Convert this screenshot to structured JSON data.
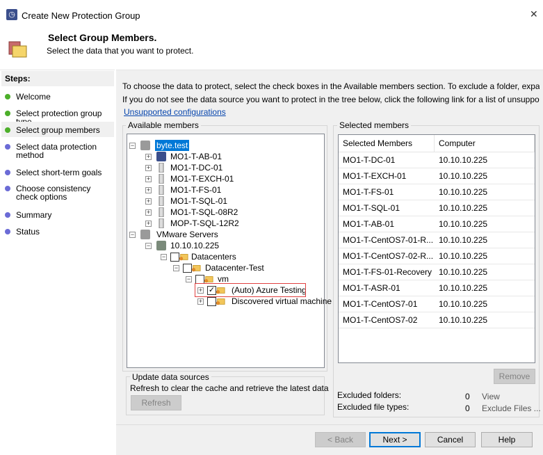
{
  "window": {
    "title": "Create New Protection Group",
    "close": "✕"
  },
  "header": {
    "title": "Select Group Members.",
    "subtitle": "Select the data that you want to protect."
  },
  "steps": {
    "heading": "Steps:",
    "items": [
      {
        "label": "Welcome",
        "state": "done"
      },
      {
        "label": "Select protection group type",
        "state": "done"
      },
      {
        "label": "Select group members",
        "state": "current"
      },
      {
        "label": "Select data protection method",
        "state": "pending"
      },
      {
        "label": "Select short-term goals",
        "state": "pending"
      },
      {
        "label": "Choose consistency check options",
        "state": "pending"
      },
      {
        "label": "Summary",
        "state": "pending"
      },
      {
        "label": "Status",
        "state": "pending"
      }
    ]
  },
  "intro": {
    "line1": "To choose the data to protect, select the check boxes in the Available members section. To exclude a folder, expand the",
    "line2": "If you do not see the data source you want to protect in the tree below, click the following link for a list of unsupported",
    "link": "Unsupported configurations"
  },
  "available": {
    "label": "Available members",
    "tree": [
      {
        "label": "byte.test",
        "level": 0,
        "icon": "domain-icon",
        "expander": "−",
        "selected": true
      },
      {
        "label": "MO1-T-AB-01",
        "level": 1,
        "icon": "dpm-server-icon",
        "expander": "+"
      },
      {
        "label": "MO1-T-DC-01",
        "level": 1,
        "icon": "server-icon",
        "expander": "+"
      },
      {
        "label": "MO1-T-EXCH-01",
        "level": 1,
        "icon": "server-icon",
        "expander": "+"
      },
      {
        "label": "MO1-T-FS-01",
        "level": 1,
        "icon": "server-icon",
        "expander": "+"
      },
      {
        "label": "MO1-T-SQL-01",
        "level": 1,
        "icon": "server-icon",
        "expander": "+"
      },
      {
        "label": "MO1-T-SQL-08R2",
        "level": 1,
        "icon": "server-icon",
        "expander": "+"
      },
      {
        "label": "MOP-T-SQL-12R2",
        "level": 1,
        "icon": "server-icon",
        "expander": "+"
      },
      {
        "label": "VMware Servers",
        "level": 0,
        "icon": "domain-icon",
        "expander": "−"
      },
      {
        "label": "10.10.10.225",
        "level": 1,
        "icon": "vmware-host-icon",
        "expander": "−"
      },
      {
        "label": "Datacenters",
        "level": 2,
        "icon": "folder-icon",
        "expander": "−",
        "checkbox": false
      },
      {
        "label": "Datacenter-Test",
        "level": 3,
        "icon": "folder-icon",
        "expander": "−",
        "checkbox": false
      },
      {
        "label": "vm",
        "level": 4,
        "icon": "folder-icon",
        "expander": "−",
        "checkbox": false
      },
      {
        "label": "(Auto) Azure Testing",
        "level": 5,
        "icon": "folder-icon",
        "expander": "+",
        "checkbox": true,
        "highlighted": true
      },
      {
        "label": "Discovered virtual machine",
        "level": 5,
        "icon": "folder-icon",
        "expander": "+",
        "checkbox": false
      }
    ]
  },
  "update": {
    "label": "Update data sources",
    "text": "Refresh to clear the cache and retrieve the latest data",
    "refresh": "Refresh"
  },
  "selected": {
    "label": "Selected members",
    "columns": [
      "Selected Members",
      "Computer"
    ],
    "rows": [
      [
        "MO1-T-DC-01",
        "10.10.10.225"
      ],
      [
        "MO1-T-EXCH-01",
        "10.10.10.225"
      ],
      [
        "MO1-T-FS-01",
        "10.10.10.225"
      ],
      [
        "MO1-T-SQL-01",
        "10.10.10.225"
      ],
      [
        "MO1-T-AB-01",
        "10.10.10.225"
      ],
      [
        "MO1-T-CentOS7-01-R...",
        "10.10.10.225"
      ],
      [
        "MO1-T-CentOS7-02-R...",
        "10.10.10.225"
      ],
      [
        "MO1-T-FS-01-Recovery",
        "10.10.10.225"
      ],
      [
        "MO1-T-ASR-01",
        "10.10.10.225"
      ],
      [
        "MO1-T-CentOS7-01",
        "10.10.10.225"
      ],
      [
        "MO1-T-CentOS7-02",
        "10.10.10.225"
      ]
    ],
    "remove": "Remove",
    "excluded_folders_label": "Excluded folders:",
    "excluded_folders": "0",
    "view": "View",
    "excluded_types_label": "Excluded file types:",
    "excluded_types": "0",
    "exclude_files": "Exclude Files ..."
  },
  "buttons": {
    "back": "< Back",
    "next": "Next >",
    "cancel": "Cancel",
    "help": "Help"
  },
  "colors": {
    "done": "#4caf2a",
    "pending": "#6b6bd6",
    "selection": "#0078d7",
    "highlight": "#e04040"
  }
}
